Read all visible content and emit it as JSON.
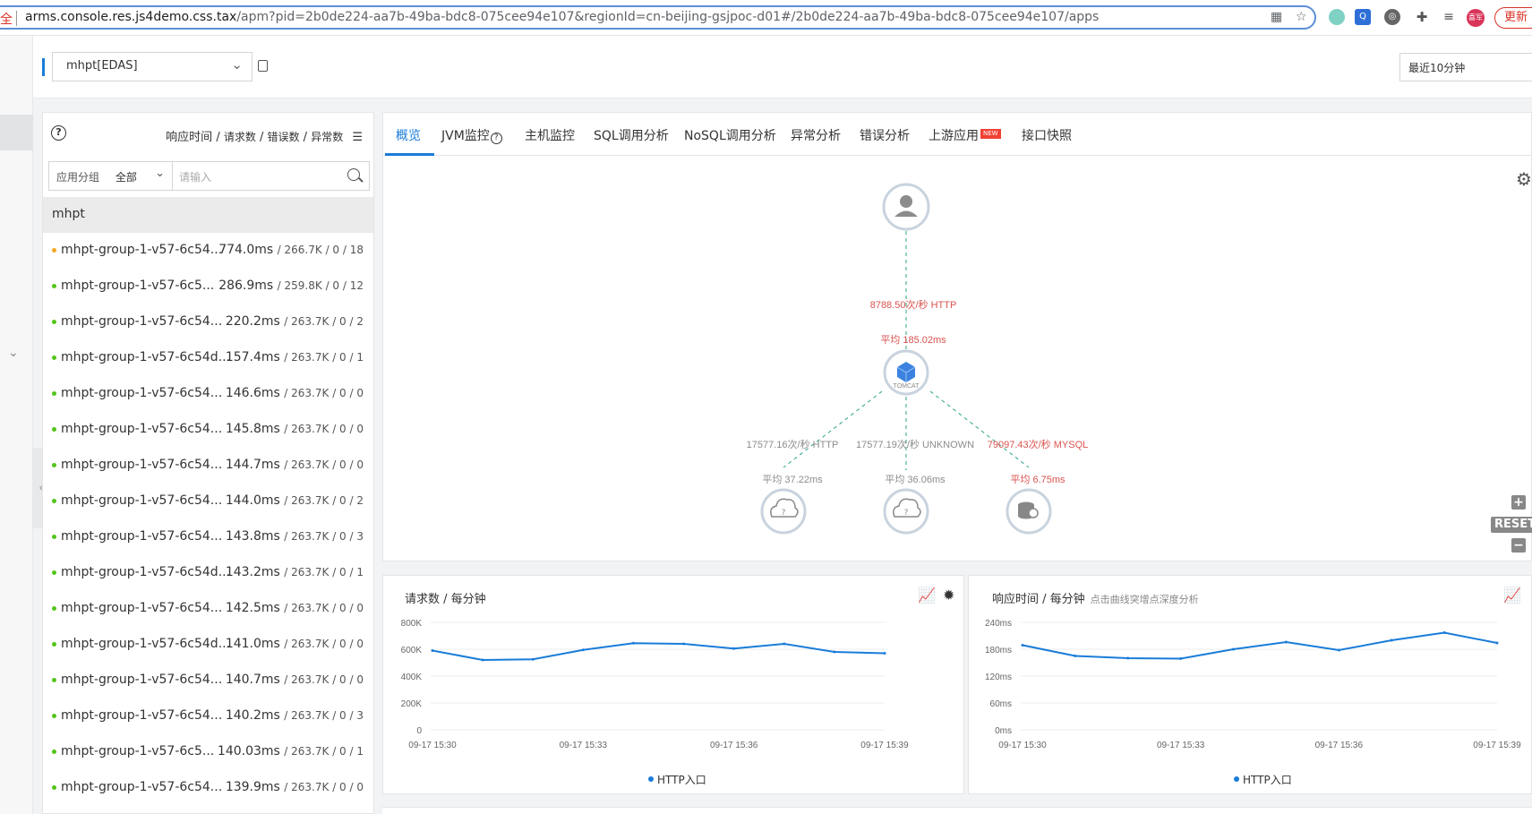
{
  "browser": {
    "security_label": "全",
    "url_host": "arms.console.res.js4demo.css.tax",
    "url_path": "/apm?pid=2b0de224-aa7b-49ba-bdc8-075cee94e107&regionId=cn-beijing-gsjpoc-d01#/2b0de224-aa7b-49ba-bdc8-075cee94e107/apps",
    "profile_label": "喜军",
    "update_label": "更新"
  },
  "toolbar": {
    "app_selected": "mhpt[EDAS]",
    "time_range": "最近10分钟"
  },
  "app_list": {
    "metrics_title": {
      "response_time": "响应时间",
      "requests": "请求数",
      "errors": "错误数",
      "exceptions": "异常数"
    },
    "filter_group_label": "应用分组",
    "filter_group_value": "全部",
    "search_placeholder": "请输入",
    "group_name": "mhpt",
    "rows": [
      {
        "name": "mhpt-group-1-v57-6c54...",
        "rt": "774.0ms",
        "rest": "/ 266.7K / 0 / 18",
        "status": "warn"
      },
      {
        "name": "mhpt-group-1-v57-6c5...",
        "rt": "286.9ms",
        "rest": "/ 259.8K / 0 / 12",
        "status": "ok"
      },
      {
        "name": "mhpt-group-1-v57-6c54...",
        "rt": "220.2ms",
        "rest": "/ 263.7K / 0 / 2",
        "status": "ok"
      },
      {
        "name": "mhpt-group-1-v57-6c54d...",
        "rt": "157.4ms",
        "rest": "/ 263.7K / 0 / 1",
        "status": "ok"
      },
      {
        "name": "mhpt-group-1-v57-6c54...",
        "rt": "146.6ms",
        "rest": "/ 263.7K / 0 / 0",
        "status": "ok"
      },
      {
        "name": "mhpt-group-1-v57-6c54...",
        "rt": "145.8ms",
        "rest": "/ 263.7K / 0 / 0",
        "status": "ok"
      },
      {
        "name": "mhpt-group-1-v57-6c54...",
        "rt": "144.7ms",
        "rest": "/ 263.7K / 0 / 0",
        "status": "ok"
      },
      {
        "name": "mhpt-group-1-v57-6c54...",
        "rt": "144.0ms",
        "rest": "/ 263.7K / 0 / 2",
        "status": "ok"
      },
      {
        "name": "mhpt-group-1-v57-6c54...",
        "rt": "143.8ms",
        "rest": "/ 263.7K / 0 / 3",
        "status": "ok"
      },
      {
        "name": "mhpt-group-1-v57-6c54d...",
        "rt": "143.2ms",
        "rest": "/ 263.7K / 0 / 1",
        "status": "ok"
      },
      {
        "name": "mhpt-group-1-v57-6c54...",
        "rt": "142.5ms",
        "rest": "/ 263.7K / 0 / 0",
        "status": "ok"
      },
      {
        "name": "mhpt-group-1-v57-6c54d...",
        "rt": "141.0ms",
        "rest": "/ 263.7K / 0 / 0",
        "status": "ok"
      },
      {
        "name": "mhpt-group-1-v57-6c54...",
        "rt": "140.7ms",
        "rest": "/ 263.7K / 0 / 0",
        "status": "ok"
      },
      {
        "name": "mhpt-group-1-v57-6c54...",
        "rt": "140.2ms",
        "rest": "/ 263.7K / 0 / 3",
        "status": "ok"
      },
      {
        "name": "mhpt-group-1-v57-6c5...",
        "rt": "140.03ms",
        "rest": "/ 263.7K / 0 / 1",
        "status": "ok"
      },
      {
        "name": "mhpt-group-1-v57-6c54...",
        "rt": "139.9ms",
        "rest": "/ 263.7K / 0 / 0",
        "status": "ok"
      }
    ]
  },
  "tabs": [
    {
      "label": "概览",
      "active": true
    },
    {
      "label": "JVM监控",
      "active": false
    },
    {
      "label": "主机监控",
      "active": false
    },
    {
      "label": "SQL调用分析",
      "active": false
    },
    {
      "label": "NoSQL调用分析",
      "active": false
    },
    {
      "label": "异常分析",
      "active": false
    },
    {
      "label": "错误分析",
      "active": false
    },
    {
      "label": "上游应用",
      "active": false,
      "badge": "NEW"
    },
    {
      "label": "接口快照",
      "active": false
    }
  ],
  "topology": {
    "tomcat_label": "TOMCAT",
    "user_edge_rate": "8788.50次/秒 HTTP",
    "user_edge_avg": "平均 185.02ms",
    "down_edges": [
      {
        "rate": "17577.16次/秒 HTTP",
        "avg": "平均 37.22ms",
        "node_icon": "cloud-question-icon",
        "highlight": false
      },
      {
        "rate": "17577.19次/秒 UNKNOWN",
        "avg": "平均 36.06ms",
        "node_icon": "cloud-question-icon",
        "highlight": false
      },
      {
        "rate": "79097.43次/秒 MYSQL",
        "avg": "平均 6.75ms",
        "node_icon": "database-icon",
        "highlight": true
      }
    ],
    "reset_label": "RESET"
  },
  "colors": {
    "accent": "#1a7cd9",
    "edge_red": "#d9534f",
    "edge_gray": "#8c8c8c",
    "ok_dot": "#52c41a",
    "warn_dot": "#f5a623"
  },
  "chart_data": [
    {
      "type": "line",
      "title": "请求数 / 每分钟",
      "x": [
        "09-17 15:30",
        "09-17 15:31",
        "09-17 15:32",
        "09-17 15:33",
        "09-17 15:34",
        "09-17 15:35",
        "09-17 15:36",
        "09-17 15:37",
        "09-17 15:38",
        "09-17 15:39"
      ],
      "xticks": [
        "09-17 15:30",
        "09-17 15:33",
        "09-17 15:36",
        "09-17 15:39"
      ],
      "yticks": [
        "800K",
        "600K",
        "400K",
        "200K",
        "0"
      ],
      "ylim": [
        0,
        800000
      ],
      "series": [
        {
          "name": "HTTP入口",
          "values": [
            590000,
            520000,
            525000,
            595000,
            645000,
            640000,
            605000,
            640000,
            580000,
            570000
          ]
        }
      ]
    },
    {
      "type": "line",
      "title": "响应时间 / 每分钟",
      "subtitle": "点击曲线突增点深度分析",
      "x": [
        "09-17 15:30",
        "09-17 15:31",
        "09-17 15:32",
        "09-17 15:33",
        "09-17 15:34",
        "09-17 15:35",
        "09-17 15:36",
        "09-17 15:37",
        "09-17 15:38",
        "09-17 15:39"
      ],
      "xticks": [
        "09-17 15:30",
        "09-17 15:33",
        "09-17 15:36",
        "09-17 15:39"
      ],
      "yticks": [
        "240ms",
        "180ms",
        "120ms",
        "60ms",
        "0ms"
      ],
      "ylim": [
        0,
        240
      ],
      "series": [
        {
          "name": "HTTP入口",
          "values": [
            189,
            165,
            160,
            159,
            180,
            196,
            178,
            200,
            217,
            194
          ]
        }
      ]
    }
  ]
}
